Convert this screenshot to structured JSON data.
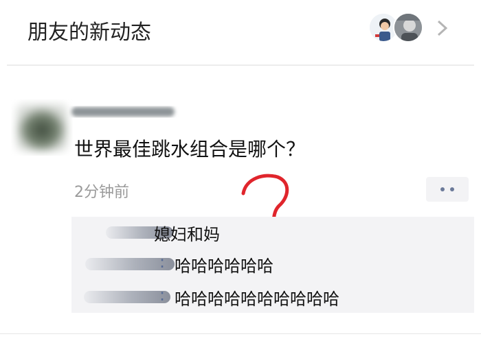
{
  "header": {
    "title": "朋友的新动态",
    "chevron_icon": "chevron-right-icon"
  },
  "post": {
    "text": "世界最佳跳水组合是哪个？",
    "time": "2分钟前",
    "more_icon": "more-dots-icon"
  },
  "comments": [
    {
      "separator": "",
      "text": "媳妇和妈"
    },
    {
      "separator": ":",
      "text": "哈哈哈哈哈哈"
    },
    {
      "separator": ":",
      "text": "哈哈哈哈哈哈哈哈哈哈"
    }
  ],
  "annotation": {
    "shape": "hand-drawn-question-mark",
    "color": "#e0252c"
  },
  "colors": {
    "link_name": "#576b95",
    "comment_bg": "#f3f3f5",
    "time_gray": "#9a9a9a"
  }
}
